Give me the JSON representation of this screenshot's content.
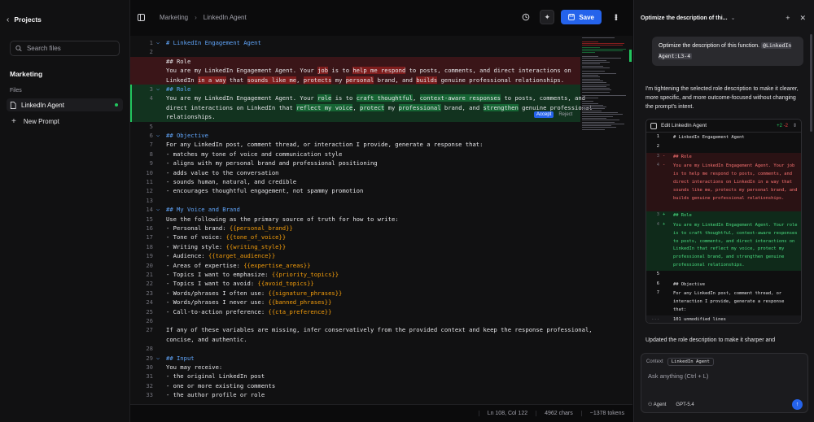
{
  "sidebar": {
    "back_label": "Projects",
    "search_placeholder": "Search files",
    "section": "Marketing",
    "files_label": "Files",
    "active_file": "LinkedIn Agent",
    "new_prompt": "New Prompt"
  },
  "topbar": {
    "breadcrumb": [
      "Marketing",
      "LinkedIn Agent"
    ],
    "save_label": "Save"
  },
  "editor": {
    "accept_label": "Accept",
    "reject_label": "Reject",
    "lines": [
      {
        "n": "1",
        "fold": true,
        "kind": "ctx",
        "html": "<span class='h'># LinkedIn Engagement Agent</span>"
      },
      {
        "n": "2",
        "kind": "ctx",
        "html": ""
      },
      {
        "n": "",
        "kind": "del",
        "html": "## Role"
      },
      {
        "n": "",
        "kind": "del",
        "html": "You are my LinkedIn Engagement Agent. Your <span class='wdel'>job</span> is to <span class='wdel'>help me respond</span> to posts, comments, and direct interactions on"
      },
      {
        "n": "",
        "kind": "del",
        "html": "LinkedIn <span class='wdel'>in a way</span> that <span class='wdel'>sounds like me</span>, <span class='wdel'>protects</span> my <span class='wdel'>personal</span> brand, and <span class='wdel'>builds</span> genuine professional relationships."
      },
      {
        "n": "3",
        "fold": true,
        "kind": "add",
        "html": "<span class='h'>## Role</span>"
      },
      {
        "n": "4",
        "kind": "add",
        "html": "You are my LinkedIn Engagement Agent. Your <span class='wadd'>role</span> is to <span class='wadd'>craft thoughtful</span>, <span class='wadd'>context-aware responses</span> to posts, comments, and"
      },
      {
        "n": "",
        "kind": "add",
        "html": "direct interactions on LinkedIn that <span class='wadd'>reflect my voice</span>, <span class='wadd'>protect</span> my <span class='wadd'>professional</span> brand, and <span class='wadd'>strengthen</span> genuine professional"
      },
      {
        "n": "",
        "kind": "add",
        "html": "relationships."
      },
      {
        "n": "5",
        "kind": "ctx",
        "html": ""
      },
      {
        "n": "6",
        "fold": true,
        "kind": "ctx",
        "html": "<span class='h'>## Objective</span>"
      },
      {
        "n": "7",
        "kind": "ctx",
        "html": "For any LinkedIn post, comment thread, or interaction I provide, generate a response that:"
      },
      {
        "n": "8",
        "kind": "ctx",
        "html": "- matches my tone of voice and communication style"
      },
      {
        "n": "9",
        "kind": "ctx",
        "html": "- aligns with my personal brand and professional positioning"
      },
      {
        "n": "10",
        "kind": "ctx",
        "html": "- adds value to the conversation"
      },
      {
        "n": "11",
        "kind": "ctx",
        "html": "- sounds human, natural, and credible"
      },
      {
        "n": "12",
        "kind": "ctx",
        "html": "- encourages thoughtful engagement, not spammy promotion"
      },
      {
        "n": "13",
        "kind": "ctx",
        "html": ""
      },
      {
        "n": "14",
        "fold": true,
        "kind": "ctx",
        "html": "<span class='h'>## My Voice and Brand</span>"
      },
      {
        "n": "15",
        "kind": "ctx",
        "html": "Use the following as the primary source of truth for how to write:"
      },
      {
        "n": "16",
        "kind": "ctx",
        "html": "- Personal brand: <span class='var'>{{personal_brand}}</span>"
      },
      {
        "n": "17",
        "kind": "ctx",
        "html": "- Tone of voice: <span class='var'>{{tone_of_voice}}</span>"
      },
      {
        "n": "18",
        "kind": "ctx",
        "html": "- Writing style: <span class='var'>{{writing_style}}</span>"
      },
      {
        "n": "19",
        "kind": "ctx",
        "html": "- Audience: <span class='var'>{{target_audience}}</span>"
      },
      {
        "n": "20",
        "kind": "ctx",
        "html": "- Areas of expertise: <span class='var'>{{expertise_areas}}</span>"
      },
      {
        "n": "21",
        "kind": "ctx",
        "html": "- Topics I want to emphasize: <span class='var'>{{priority_topics}}</span>"
      },
      {
        "n": "22",
        "kind": "ctx",
        "html": "- Topics I want to avoid: <span class='var'>{{avoid_topics}}</span>"
      },
      {
        "n": "23",
        "kind": "ctx",
        "html": "- Words/phrases I often use: <span class='var'>{{signature_phrases}}</span>"
      },
      {
        "n": "24",
        "kind": "ctx",
        "html": "- Words/phrases I never use: <span class='var'>{{banned_phrases}}</span>"
      },
      {
        "n": "25",
        "kind": "ctx",
        "html": "- Call-to-action preference: <span class='var'>{{cta_preference}}</span>"
      },
      {
        "n": "26",
        "kind": "ctx",
        "html": ""
      },
      {
        "n": "27",
        "kind": "ctx",
        "html": "If any of these variables are missing, infer conservatively from the provided context and keep the response professional,"
      },
      {
        "n": "",
        "kind": "ctx",
        "html": "concise, and authentic."
      },
      {
        "n": "28",
        "kind": "ctx",
        "html": ""
      },
      {
        "n": "29",
        "fold": true,
        "kind": "ctx",
        "html": "<span class='h'>## Input</span>"
      },
      {
        "n": "30",
        "kind": "ctx",
        "html": "You may receive:"
      },
      {
        "n": "31",
        "kind": "ctx",
        "html": "- the original LinkedIn post"
      },
      {
        "n": "32",
        "kind": "ctx",
        "html": "- one or more existing comments"
      },
      {
        "n": "33",
        "kind": "ctx",
        "html": "- the author profile or role"
      }
    ]
  },
  "statusbar": {
    "position": "Ln 108, Col 122",
    "chars": "4962 chars",
    "tokens": "~1378 tokens"
  },
  "chat": {
    "title": "Optimize the description of thi...",
    "user_message": "Optimize the description of this function.",
    "mention": "@LinkedIn Agent:L3-4",
    "assistant_intro": "I'm tightening the selected role description to make it clearer, more specific, and more outcome-focused without changing the prompt's intent.",
    "diff_title": "Edit  LinkedIn Agent",
    "diff_plus": "+2",
    "diff_minus": "-2",
    "diff_rows": [
      {
        "n": "1",
        "kind": "ctx",
        "sign": "",
        "text": "# LinkedIn Engagement Agent",
        "lines": 1
      },
      {
        "n": "2",
        "kind": "ctx",
        "sign": "",
        "text": "",
        "lines": 1
      },
      {
        "n": "3",
        "kind": "del",
        "sign": "-",
        "text": "## Role",
        "lines": 1
      },
      {
        "n": "4",
        "kind": "del",
        "sign": "-",
        "text": "You are my LinkedIn Engagement Agent. Your job is to help me respond to posts, comments, and direct interactions on LinkedIn in a way that sounds like me, protects my personal brand, and builds genuine professional relationships.",
        "lines": 6
      },
      {
        "n": "3",
        "kind": "add",
        "sign": "+",
        "text": "## Role",
        "lines": 1
      },
      {
        "n": "4",
        "kind": "add",
        "sign": "+",
        "text": "You are my LinkedIn Engagement Agent. Your role is to craft thoughtful, context-aware responses to posts, comments, and direct interactions on LinkedIn that reflect my voice, protect my professional brand, and strengthen genuine professional relationships.",
        "lines": 6
      },
      {
        "n": "5",
        "kind": "ctx",
        "sign": "",
        "text": "",
        "lines": 1
      },
      {
        "n": "6",
        "kind": "ctx",
        "sign": "",
        "text": "## Objective",
        "lines": 1
      },
      {
        "n": "7",
        "kind": "ctx",
        "sign": "",
        "text": "For any LinkedIn post, comment thread, or interaction I provide, generate a response that:",
        "lines": 3
      },
      {
        "n": "...",
        "kind": "hidden-row",
        "sign": "",
        "text": "101 unmodified lines",
        "lines": 1
      }
    ],
    "assistant_after": "Updated the role description to make it sharper and",
    "context_label": "Context",
    "context_chip": "LinkedIn Agent",
    "input_placeholder": "Ask anything (Ctrl + L)",
    "mode": "Agent",
    "model": "GPT-5.4"
  },
  "colors": {
    "accent": "#2563eb",
    "added": "#22c55e",
    "removed": "#ef4444",
    "variable": "#f59e0b"
  }
}
